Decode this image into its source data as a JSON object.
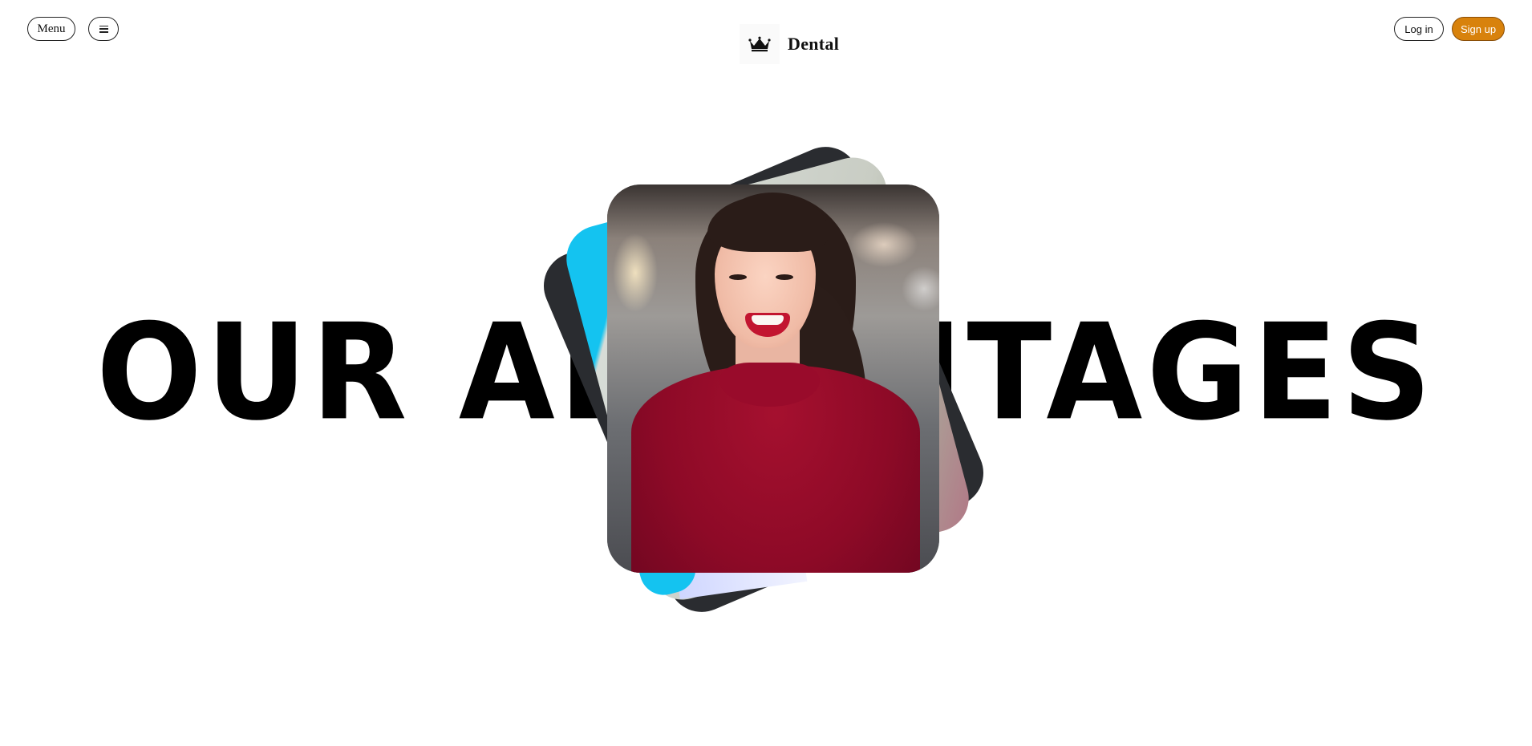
{
  "header": {
    "menu_label": "Menu",
    "hamburger_icon": "hamburger-icon",
    "brand": {
      "icon": "crown-icon",
      "name": "Dental"
    },
    "login_label": "Log in",
    "signup_label": "Sign up"
  },
  "hero": {
    "title": "OUR ADVANTAGES",
    "photo_stack": {
      "cards_visible": 3,
      "front_photo": "smiling woman in red turtleneck"
    }
  },
  "colors": {
    "background": "#ffffff",
    "text": "#000000",
    "accent_signup": "#d8820c",
    "card_dark": "#2a2c30",
    "card_blue": "#14c3f0"
  }
}
